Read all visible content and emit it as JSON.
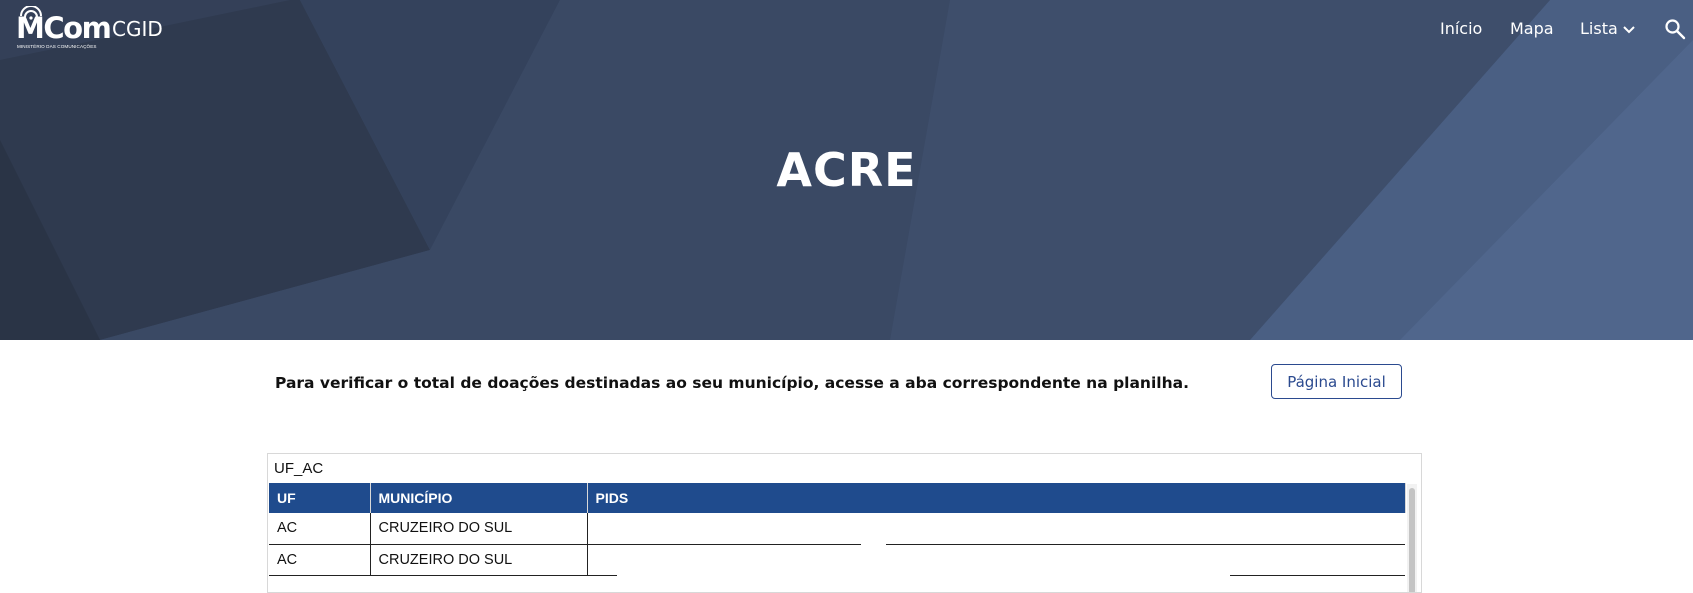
{
  "header": {
    "logo_text": "MCom",
    "logo_subtext": "MINISTÉRIO DAS COMUNICAÇÕES",
    "site_name": "CGID",
    "nav": [
      {
        "label": "Início"
      },
      {
        "label": "Mapa"
      },
      {
        "label": "Lista",
        "icon": "chevron-down-icon"
      }
    ],
    "search_icon": "search-icon"
  },
  "hero": {
    "title": "ACRE"
  },
  "main": {
    "instruction": "Para verificar o total de doações destinadas ao seu município, acesse a aba correspondente na planilha.",
    "home_button_label": "Página Inicial"
  },
  "spreadsheet": {
    "sheet_name": "UF_AC",
    "columns": [
      "UF",
      "MUNICÍPIO",
      "PIDS"
    ],
    "rows": [
      [
        "AC",
        "CRUZEIRO DO SUL",
        ""
      ],
      [
        "AC",
        "CRUZEIRO DO SUL",
        ""
      ]
    ]
  },
  "colors": {
    "hero_background": "#3a4862",
    "table_header": "#1f4b8d",
    "accent": "#2b4a8f"
  }
}
